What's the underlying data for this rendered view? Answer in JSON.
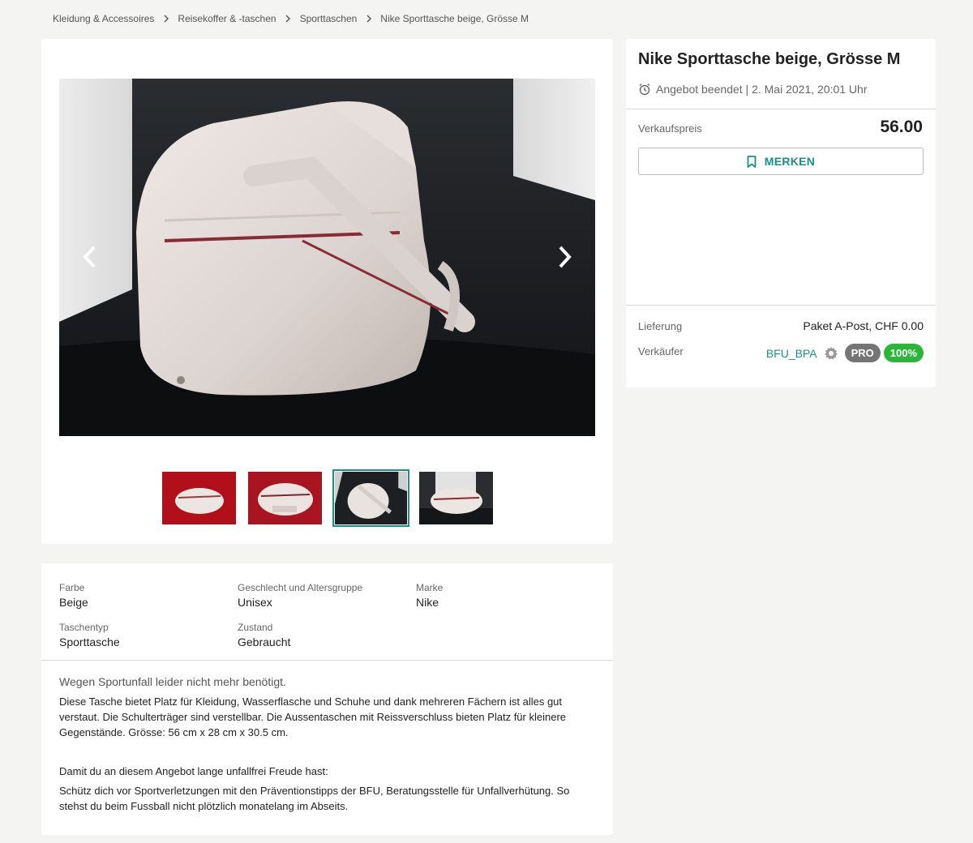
{
  "breadcrumb": [
    "Kleidung & Accessoires",
    "Reisekoffer & -taschen",
    "Sporttaschen",
    "Nike Sporttasche beige, Grösse M"
  ],
  "listing": {
    "title": "Nike Sporttasche beige, Grösse M",
    "ended": "Angebot beendet | 2. Mai 2021, 20:01 Uhr",
    "price_label": "Verkaufspreis",
    "price": "56.00",
    "merken_label": "MERKEN",
    "delivery_label": "Lieferung",
    "delivery_value": "Paket A-Post, CHF 0.00",
    "seller_label": "Verkäufer",
    "seller_name": "BFU_BPA",
    "pro_badge": "PRO",
    "rating_badge": "100%"
  },
  "gallery": {
    "active_index": 2,
    "thumb_count": 4
  },
  "attributes": [
    {
      "key": "Farbe",
      "value": "Beige"
    },
    {
      "key": "Geschlecht und Altersgruppe",
      "value": "Unisex"
    },
    {
      "key": "Marke",
      "value": "Nike"
    },
    {
      "key": "Taschentyp",
      "value": "Sporttasche"
    },
    {
      "key": "Zustand",
      "value": "Gebraucht"
    }
  ],
  "description": {
    "headline": "Wegen Sportunfall leider nicht mehr benötigt.",
    "paragraph1": "Diese Tasche bietet Platz für Kleidung, Wasserflasche und Schuhe und dank mehreren Fächern ist alles gut verstaut. Die Schulterträger sind verstellbar. Die Aussentaschen mit Reissverschluss bieten Platz für kleinere Gegenstände. Grösse: 56 cm x 28 cm x 30.5 cm.",
    "paragraph2": "Damit du an diesem Angebot lange unfallfrei Freude hast:",
    "paragraph3": "Schütz dich vor Sportverletzungen mit den Präventionstipps der BFU, Beratungsstelle für Unfallverhütung. So stehst du beim Fussball nicht plötzlich monatelang im Abseits."
  },
  "colors": {
    "accent": "#1a8f86",
    "rating_green": "#2bb63a",
    "pro_gray": "#757575"
  },
  "icons": [
    "chevron-right-icon",
    "chevron-left-icon",
    "alarm-clock-icon",
    "bookmark-icon",
    "gear-badge-icon"
  ]
}
